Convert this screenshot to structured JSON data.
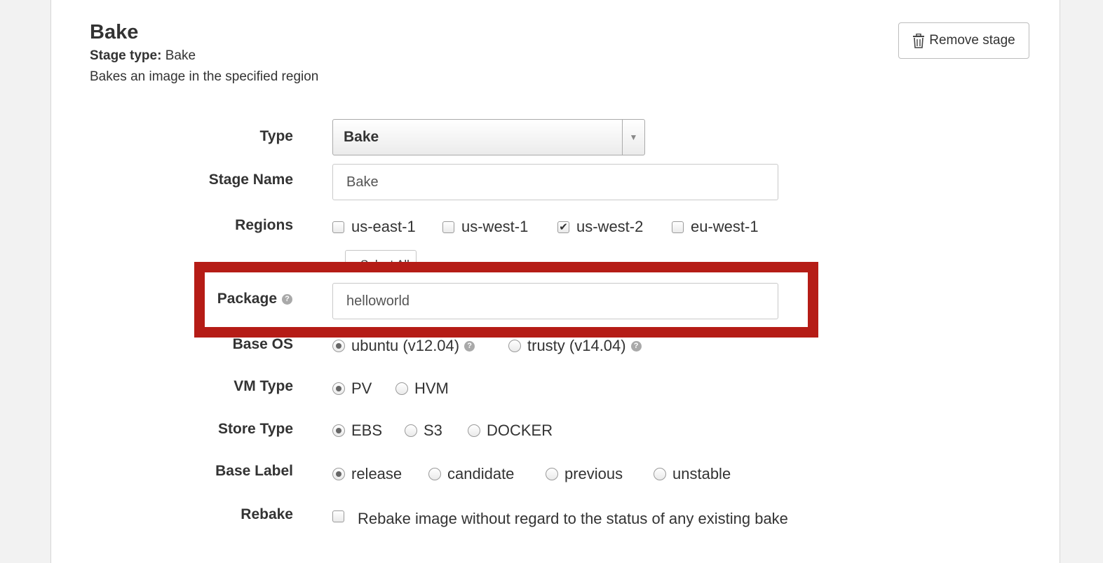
{
  "stage": {
    "title": "Bake",
    "type_label": "Stage type:",
    "type_value": "Bake",
    "description": "Bakes an image in the specified region",
    "remove_label": "Remove stage"
  },
  "form": {
    "type": {
      "label": "Type",
      "value": "Bake"
    },
    "stage_name": {
      "label": "Stage Name",
      "value": "Bake"
    },
    "regions": {
      "label": "Regions",
      "options": [
        {
          "label": "us-east-1",
          "checked": false
        },
        {
          "label": "us-west-1",
          "checked": false
        },
        {
          "label": "us-west-2",
          "checked": true
        },
        {
          "label": "eu-west-1",
          "checked": false
        }
      ],
      "select_all_label": "Select All"
    },
    "package": {
      "label": "Package",
      "value": "helloworld"
    },
    "base_os": {
      "label": "Base OS",
      "options": [
        {
          "label": "ubuntu (v12.04)",
          "selected": true
        },
        {
          "label": "trusty (v14.04)",
          "selected": false
        }
      ]
    },
    "vm_type": {
      "label": "VM Type",
      "options": [
        {
          "label": "PV",
          "selected": true
        },
        {
          "label": "HVM",
          "selected": false
        }
      ]
    },
    "store_type": {
      "label": "Store Type",
      "options": [
        {
          "label": "EBS",
          "selected": true
        },
        {
          "label": "S3",
          "selected": false
        },
        {
          "label": "DOCKER",
          "selected": false
        }
      ]
    },
    "base_label": {
      "label": "Base Label",
      "options": [
        {
          "label": "release",
          "selected": true
        },
        {
          "label": "candidate",
          "selected": false
        },
        {
          "label": "previous",
          "selected": false
        },
        {
          "label": "unstable",
          "selected": false
        }
      ]
    },
    "rebake": {
      "label": "Rebake",
      "checked": false,
      "description": "Rebake image without regard to the status of any existing bake"
    }
  },
  "colors": {
    "highlight": "#b51c16",
    "page_background": "#f2f2f2"
  }
}
